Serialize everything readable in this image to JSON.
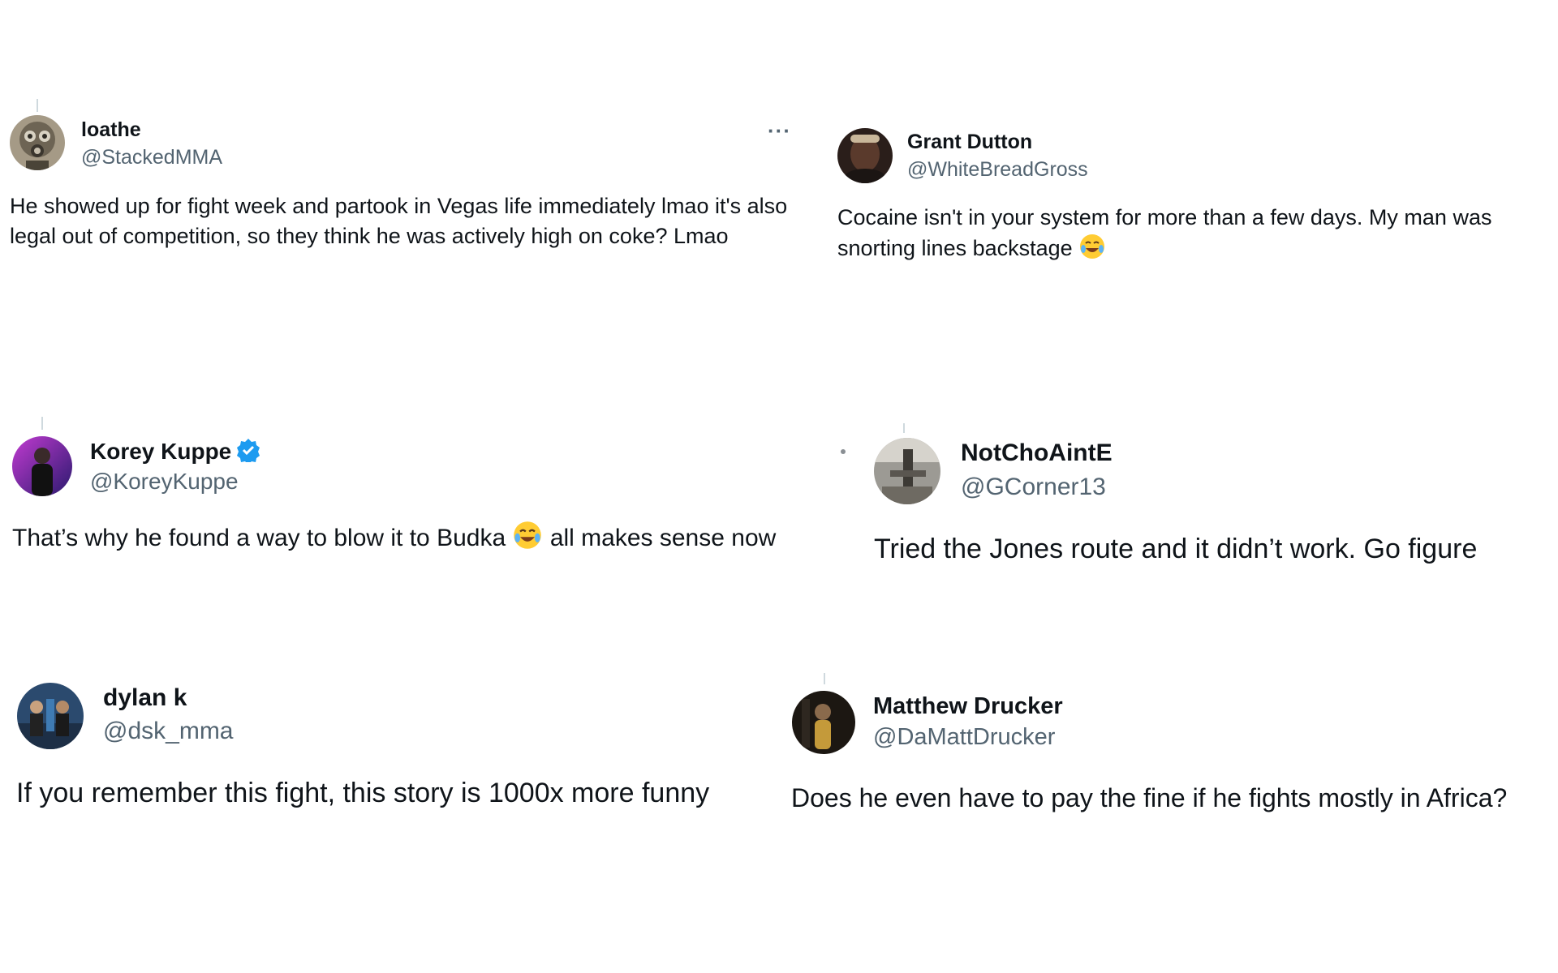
{
  "tweets": [
    {
      "name": "loathe",
      "handle": "@StackedMMA",
      "text": "He showed up for fight week and partook in Vegas life immediately lmao it's also legal out of competition, so they think he was actively high on coke? Lmao",
      "avatar_icon": "gas-mask-avatar",
      "more_label": "···"
    },
    {
      "name": "Grant Dutton",
      "handle": "@WhiteBreadGross",
      "text": "Cocaine isn't in your system for more than a few days. My man was snorting lines backstage",
      "emoji": "face-with-tears-of-joy",
      "avatar_icon": "man-portrait-avatar"
    },
    {
      "name": "Korey Kuppe",
      "handle": "@KoreyKuppe",
      "verified": true,
      "text_before": "That’s why he found a way to blow it to Budka",
      "text_after": "all makes sense now",
      "emoji": "face-with-tears-of-joy",
      "avatar_icon": "person-in-neon-avatar",
      "verified_color": "#1d9bf0"
    },
    {
      "name": "NotChoAintE",
      "handle": "@GCorner13",
      "text": "Tried the Jones route and it didn’t work. Go figure",
      "avatar_icon": "gym-avatar"
    },
    {
      "name": "dylan k",
      "handle": "@dsk_mma",
      "text": "If you remember this fight, this story is 1000x more funny",
      "avatar_icon": "fighters-avatar"
    },
    {
      "name": "Matthew Drucker",
      "handle": "@DaMattDrucker",
      "text": "Does he even have to pay the fine if he fights mostly in Africa?",
      "avatar_icon": "person-dark-avatar"
    }
  ]
}
